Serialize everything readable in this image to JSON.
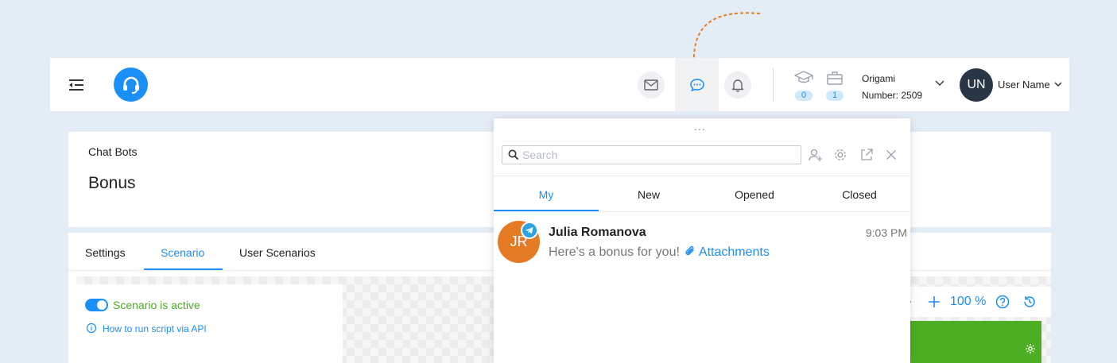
{
  "header": {
    "counters": [
      {
        "icon": "graduation-cap-icon",
        "value": "0"
      },
      {
        "icon": "briefcase-icon",
        "value": "1"
      }
    ],
    "account": {
      "name": "Origami",
      "number": "Number: 2509"
    },
    "user": {
      "initials": "UN",
      "name": "User Name"
    }
  },
  "page": {
    "breadcrumb": "Chat Bots",
    "title": "Bonus",
    "tabs": [
      {
        "label": "Settings"
      },
      {
        "label": "Scenario",
        "active": true
      },
      {
        "label": "User Scenarios"
      }
    ],
    "scenario": {
      "status": "Scenario is active",
      "help_link": "How to run script via API"
    },
    "zoom": "100 %"
  },
  "chat_popup": {
    "drag_handle": "...",
    "search": {
      "placeholder": "Search",
      "value": ""
    },
    "tabs": [
      {
        "label": "My",
        "active": true
      },
      {
        "label": "New"
      },
      {
        "label": "Opened"
      },
      {
        "label": "Closed"
      }
    ],
    "conversations": [
      {
        "initials": "JR",
        "name": "Julia Romanova",
        "time": "9:03 PM",
        "message": "Here's a bonus for you!",
        "attachment_label": "Attachments",
        "channel": "telegram"
      }
    ]
  },
  "colors": {
    "accent": "#1a8ff5",
    "active_green": "#4cae22",
    "avatar_orange": "#e57a24",
    "pointer_orange": "#e67e22"
  }
}
